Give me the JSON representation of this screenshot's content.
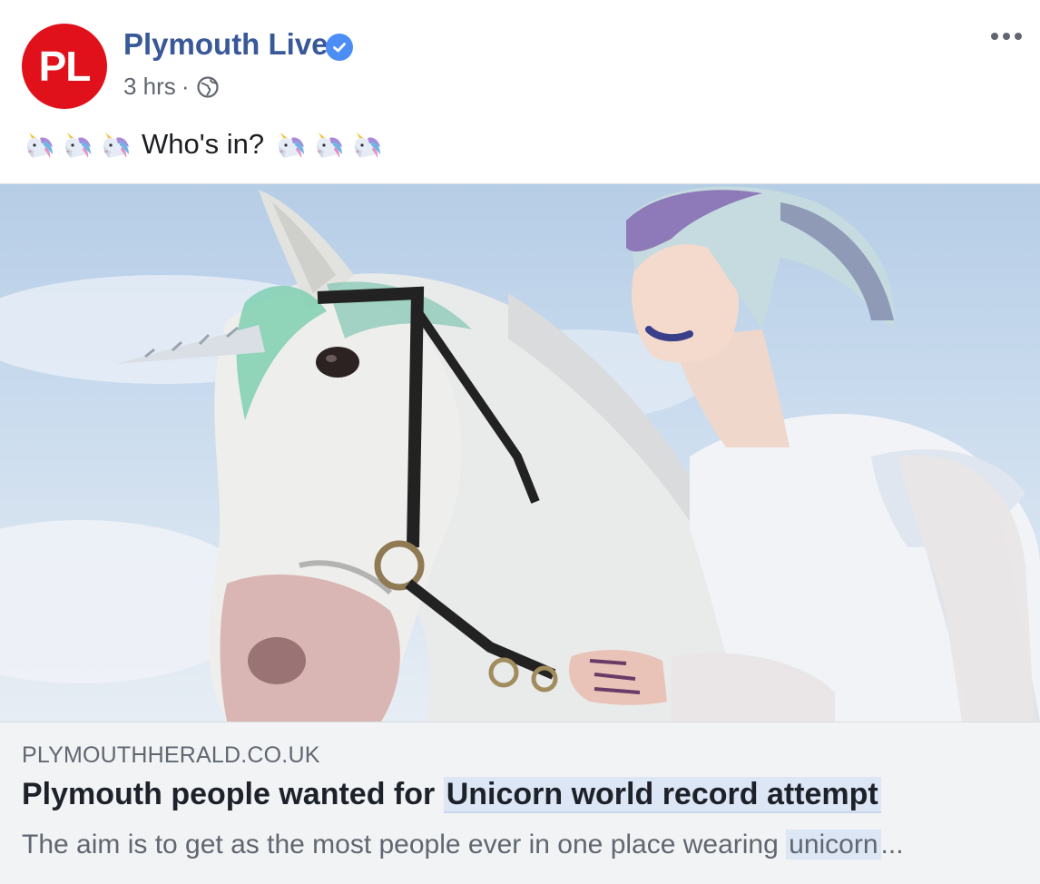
{
  "post": {
    "avatar_initials": "PL",
    "page_name": "Plymouth Live",
    "verified": true,
    "time": "3 hrs",
    "separator": "·",
    "privacy_icon": "globe-icon",
    "menu_icon": "more-options-icon",
    "text": "Who's in?",
    "emoji": "unicorn-emoji",
    "emoji_count_before": 3,
    "emoji_count_after": 3
  },
  "link_card": {
    "domain": "PLYMOUTHHERALD.CO.UK",
    "headline_prefix": "Plymouth people wanted for ",
    "headline_highlight": "Unicorn world record attempt",
    "description_prefix": "The aim is to get as the most people ever in one place wearing ",
    "description_highlight": "unicorn",
    "description_suffix": "..."
  },
  "colors": {
    "brand_red": "#e0111b",
    "link_blue": "#385898",
    "verified_blue": "#4c8df6",
    "highlight": "#dde6f5"
  }
}
